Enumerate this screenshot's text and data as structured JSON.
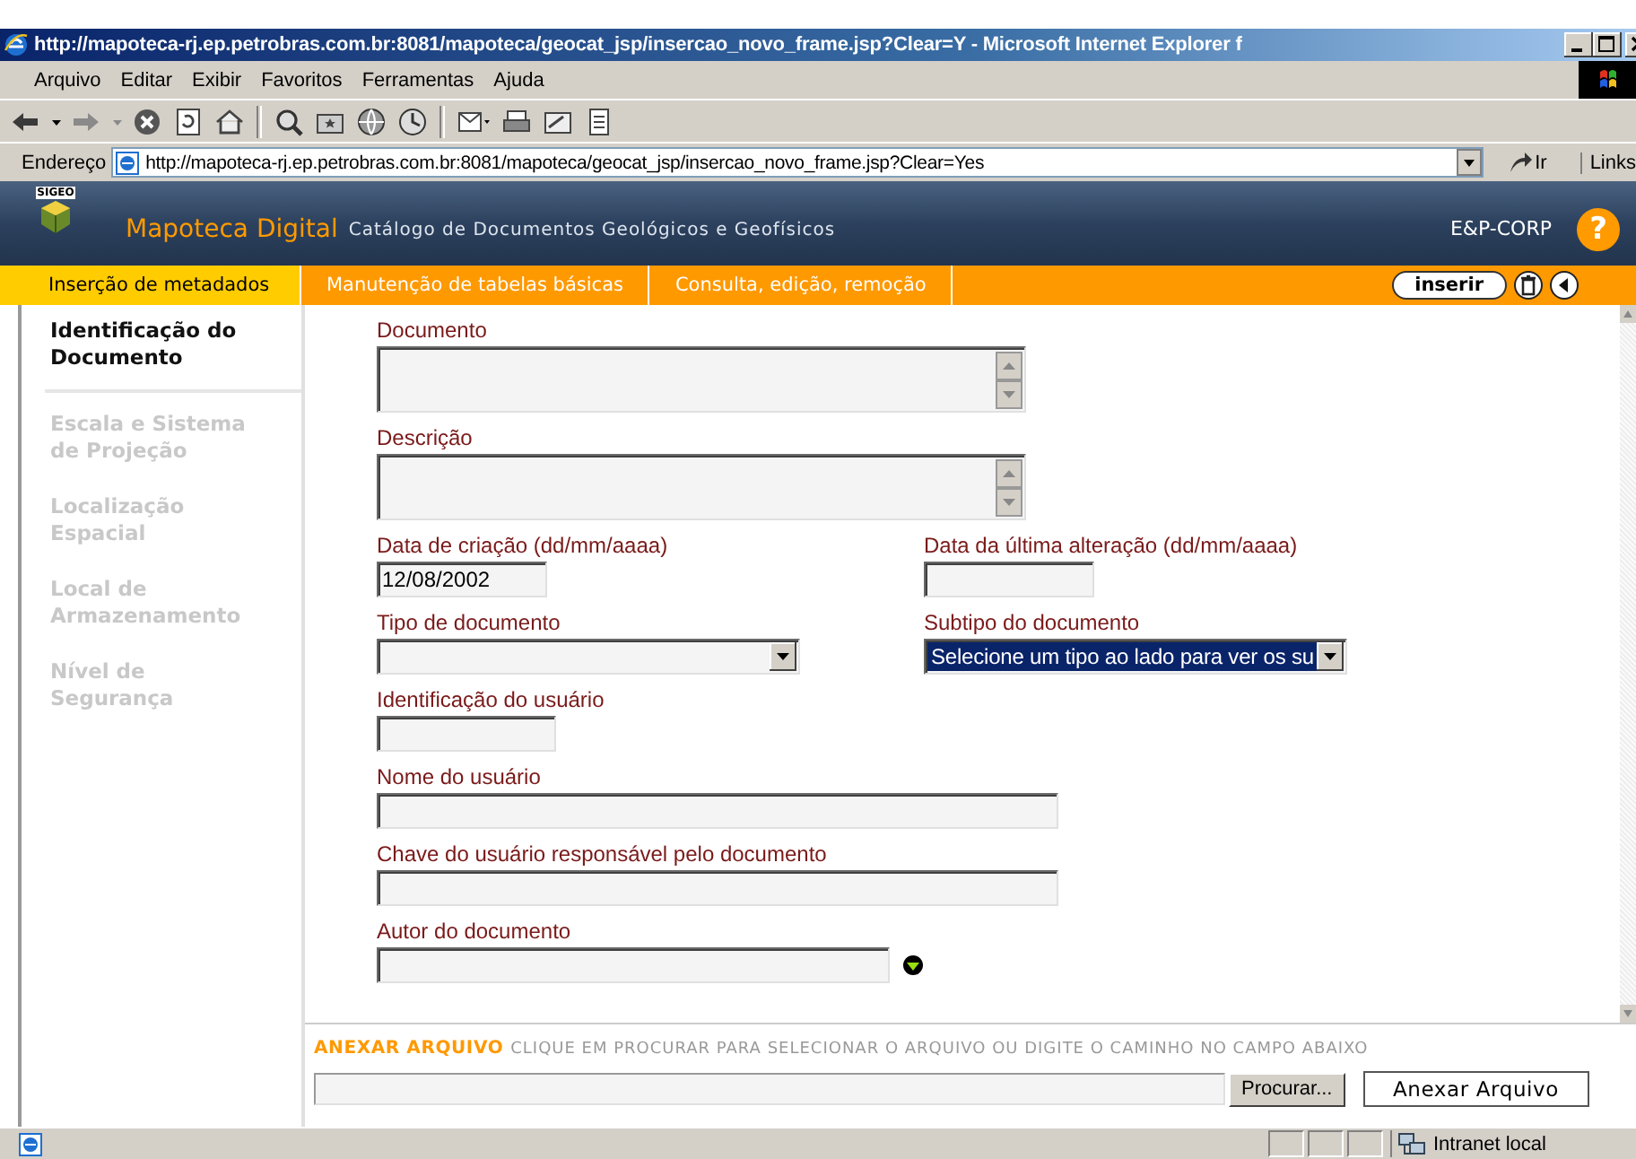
{
  "browser": {
    "title": "http://mapoteca-rj.ep.petrobras.com.br:8081/mapoteca/geocat_jsp/insercao_novo_frame.jsp?Clear=Y - Microsoft Internet Explorer f",
    "menu": [
      "Arquivo",
      "Editar",
      "Exibir",
      "Favoritos",
      "Ferramentas",
      "Ajuda"
    ],
    "address_label": "Endereço",
    "address": "http://mapoteca-rj.ep.petrobras.com.br:8081/mapoteca/geocat_jsp/insercao_novo_frame.jsp?Clear=Yes",
    "go_label": "Ir",
    "links_label": "Links"
  },
  "header": {
    "logo_text": "SIGEO",
    "app_name": "Mapoteca Digital",
    "subtitle": "Catálogo de Documentos Geológicos e Geofísicos",
    "org": "E&P-CORP",
    "help": "?"
  },
  "tabs": [
    {
      "label": "Inserção de metadados",
      "selected": true
    },
    {
      "label": "Manutenção de tabelas básicas",
      "selected": false
    },
    {
      "label": "Consulta, edição, remoção",
      "selected": false
    }
  ],
  "toolbar": {
    "insert_button": "inserir"
  },
  "sidebar": [
    {
      "label": "Identificação do Documento",
      "selected": true
    },
    {
      "label": "Escala e Sistema de Projeção",
      "selected": false
    },
    {
      "label": "Localização Espacial",
      "selected": false
    },
    {
      "label": "Local de Armazenamento",
      "selected": false
    },
    {
      "label": "Nível de Segurança",
      "selected": false
    }
  ],
  "form": {
    "rows": [
      {
        "fields": [
          {
            "label": "Documento",
            "kind": "textarea"
          }
        ]
      },
      {
        "fields": [
          {
            "label": "Descrição",
            "kind": "textarea"
          }
        ]
      },
      {
        "fields": [
          {
            "label": "Data de criação (dd/mm/aaaa)",
            "kind": "date",
            "value": "12/08/2002"
          },
          {
            "label": "Data da última alteração (dd/mm/aaaa)",
            "kind": "date"
          }
        ]
      },
      {
        "fields": [
          {
            "label": "Tipo de documento",
            "kind": "select",
            "focused": false
          },
          {
            "label": "Subtipo do documento",
            "kind": "select",
            "value": "Selecione um tipo ao lado para ver os su",
            "focused": true
          }
        ]
      },
      {
        "fields": [
          {
            "label": "Identificação do usuário",
            "kind": "code"
          }
        ]
      },
      {
        "fields": [
          {
            "label": "Nome do usuário",
            "kind": "text"
          }
        ]
      },
      {
        "fields": [
          {
            "label": "Chave do usuário responsável pelo documento",
            "kind": "text"
          }
        ]
      },
      {
        "fields": [
          {
            "label": "Autor do documento",
            "kind": "text-lookup"
          }
        ]
      }
    ]
  },
  "attach": {
    "title": "ANEXAR ARQUIVO",
    "hint": "CLIQUE EM PROCURAR PARA SELECIONAR O ARQUIVO OU DIGITE O CAMINHO NO CAMPO ABAIXO",
    "browse_button": "Procurar...",
    "attach_button": "Anexar Arquivo"
  },
  "status_bar": {
    "zone": "Intranet local"
  }
}
